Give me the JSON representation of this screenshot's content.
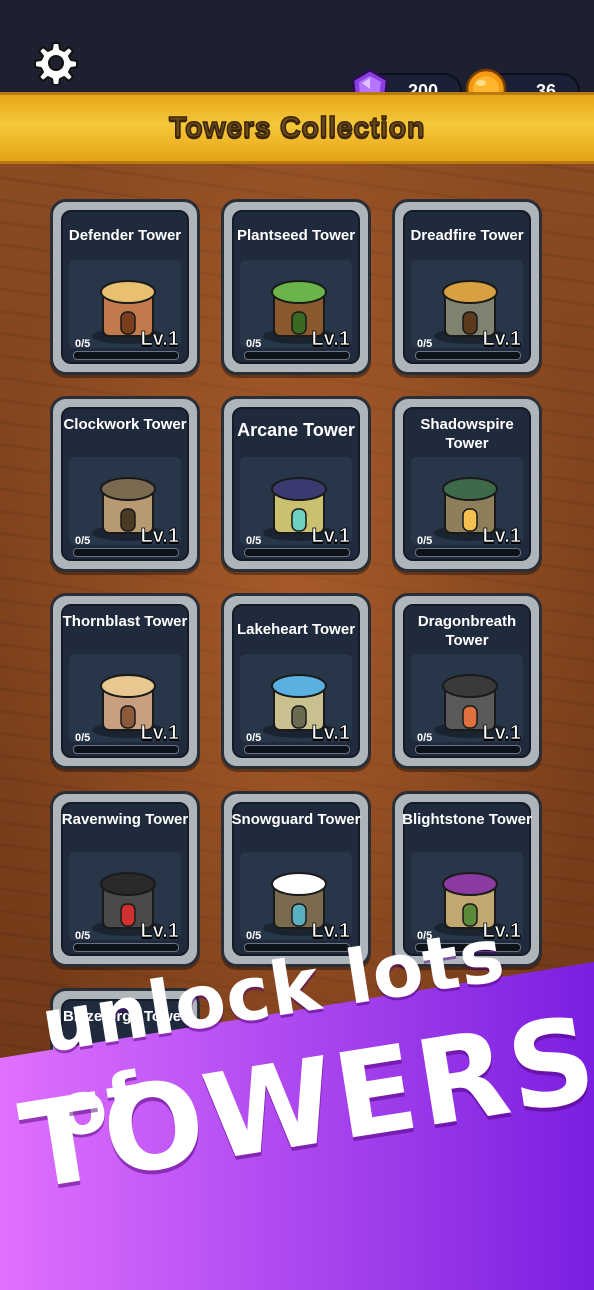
{
  "header": {
    "title": "Towers Collection",
    "settings_icon": "gear-icon",
    "gems": "200",
    "coins": "36"
  },
  "colors": {
    "banner": "#f2b82a",
    "progress_fill": "#6fd16a",
    "promo_from": "#e070ff",
    "promo_to": "#7a1fe0"
  },
  "towers": [
    {
      "name": "Defender Tower",
      "progress": "0/5",
      "level": "Lv.1",
      "fill": 0
    },
    {
      "name": "Plantseed Tower",
      "progress": "0/5",
      "level": "Lv.1",
      "fill": 0
    },
    {
      "name": "Dreadfire Tower",
      "progress": "0/5",
      "level": "Lv.1",
      "fill": 0
    },
    {
      "name": "Clockwork Tower",
      "progress": "0/5",
      "level": "Lv.1",
      "fill": 0
    },
    {
      "name": "Arcane Tower",
      "progress": "0/5",
      "level": "Lv.1",
      "fill": 0
    },
    {
      "name": "Shadowspire Tower",
      "progress": "0/5",
      "level": "Lv.1",
      "fill": 0
    },
    {
      "name": "Thornblast Tower",
      "progress": "0/5",
      "level": "Lv.1",
      "fill": 0
    },
    {
      "name": "Lakeheart Tower",
      "progress": "0/5",
      "level": "Lv.1",
      "fill": 0
    },
    {
      "name": "Dragonbreath Tower",
      "progress": "0/5",
      "level": "Lv.1",
      "fill": 0
    },
    {
      "name": "Ravenwing Tower",
      "progress": "0/5",
      "level": "Lv.1",
      "fill": 0
    },
    {
      "name": "Snowguard Tower",
      "progress": "0/5",
      "level": "Lv.1",
      "fill": 0
    },
    {
      "name": "Blightstone Tower",
      "progress": "0/5",
      "level": "Lv.1",
      "fill": 0
    },
    {
      "name": "Blazeforge Tower",
      "progress": "",
      "level": "",
      "fill": 0
    }
  ],
  "promo": {
    "line1": "unlock lots of",
    "line2": "TOWERS"
  }
}
